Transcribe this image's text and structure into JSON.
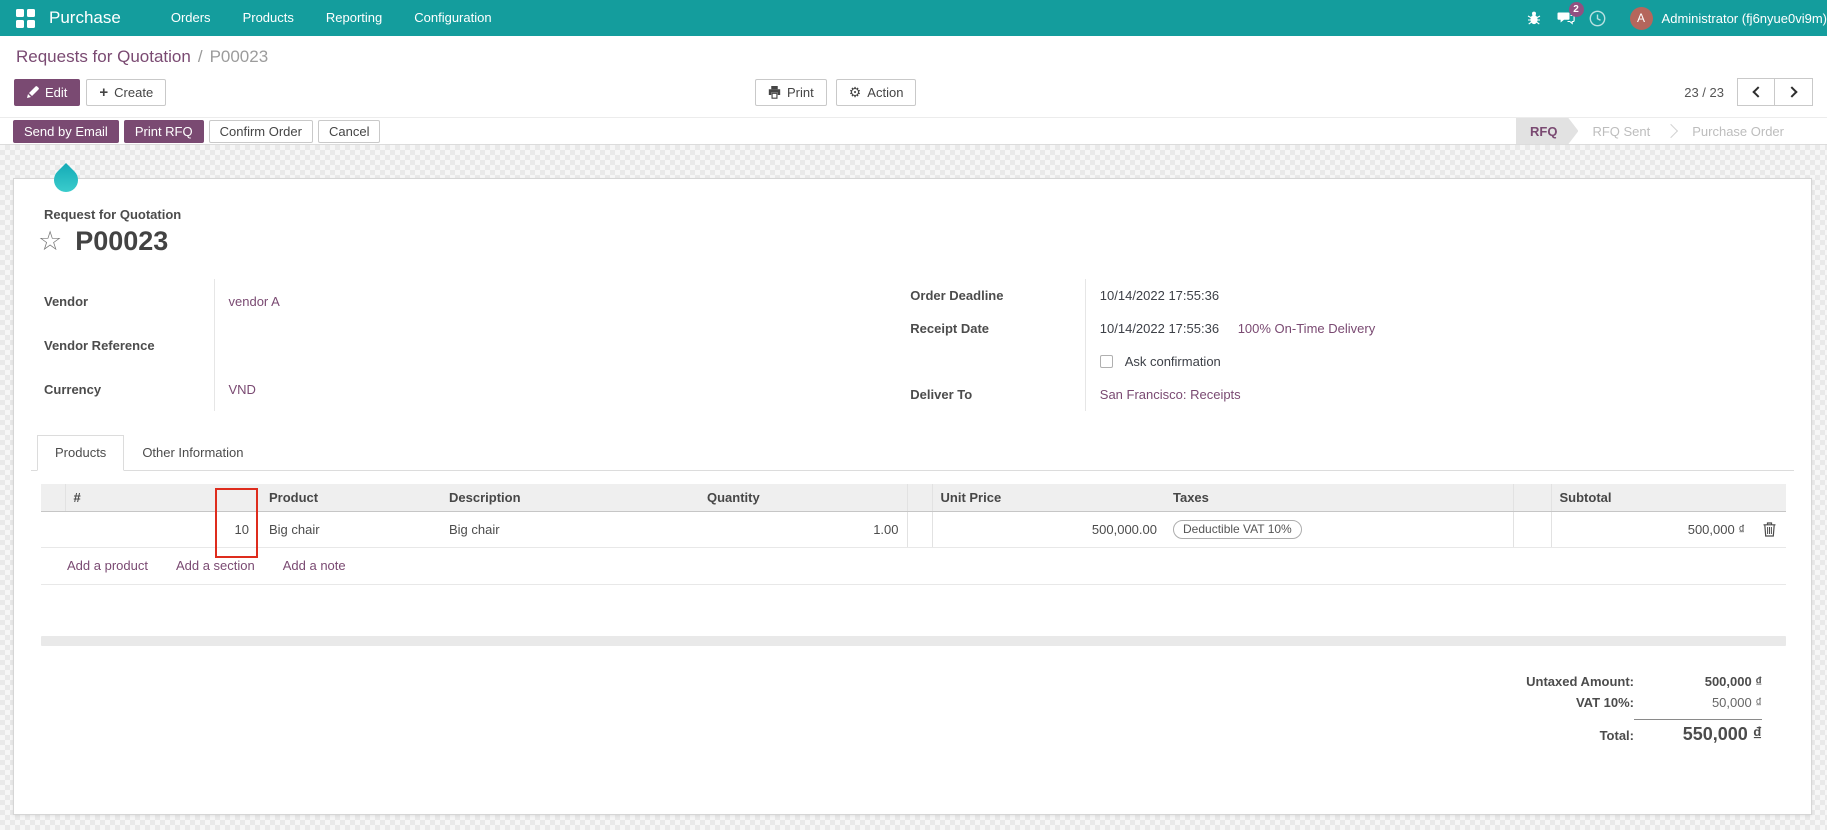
{
  "navbar": {
    "app_name": "Purchase",
    "menus": [
      {
        "label": "Orders"
      },
      {
        "label": "Products"
      },
      {
        "label": "Reporting"
      },
      {
        "label": "Configuration"
      }
    ],
    "systray": {
      "message_count": "2",
      "user_initial": "A",
      "user_name": "Administrator (fj6nyue0vi9m)"
    }
  },
  "control_panel": {
    "breadcrumb_parent": "Requests for Quotation",
    "breadcrumb_sep": "/",
    "breadcrumb_current": "P00023",
    "edit_label": "Edit",
    "create_label": "Create",
    "create_icon": "+",
    "print_label": "Print",
    "action_label": "Action",
    "action_icon": "⚙",
    "pager_value": "23 / 23"
  },
  "statusbar": {
    "send_by_email": "Send by Email",
    "print_rfq": "Print RFQ",
    "confirm_order": "Confirm Order",
    "cancel": "Cancel",
    "stages": [
      {
        "label": "RFQ",
        "active": true
      },
      {
        "label": "RFQ Sent",
        "active": false
      },
      {
        "label": "Purchase Order",
        "active": false
      }
    ]
  },
  "sheet": {
    "doc_label": "Request for Quotation",
    "title": "P00023",
    "star_icon": "☆",
    "left_fields": [
      {
        "label": "Vendor",
        "value": "vendor A"
      },
      {
        "label": "Vendor Reference",
        "value": ""
      },
      {
        "label": "Currency",
        "value": "VND"
      }
    ],
    "right_fields": {
      "order_deadline_label": "Order Deadline",
      "order_deadline_value": "10/14/2022 17:55:36",
      "receipt_date_label": "Receipt Date",
      "receipt_date_value": "10/14/2022 17:55:36",
      "on_time_link": "100% On-Time Delivery",
      "ask_confirmation_label": "Ask confirmation",
      "deliver_to_label": "Deliver To",
      "deliver_to_value": "San Francisco: Receipts"
    },
    "tabs": [
      {
        "label": "Products",
        "active": true
      },
      {
        "label": "Other Information",
        "active": false
      }
    ],
    "table": {
      "col_seq": "#",
      "col_product": "Product",
      "col_description": "Description",
      "col_quantity": "Quantity",
      "col_unit_price": "Unit Price",
      "col_taxes": "Taxes",
      "col_subtotal": "Subtotal",
      "row": {
        "seq": "10",
        "product": "Big chair",
        "description": "Big chair",
        "quantity": "1.00",
        "unit_price": "500,000.00",
        "tax_tag": "Deductible VAT 10%",
        "subtotal": "500,000 ₫"
      },
      "add_product": "Add a product",
      "add_section": "Add a section",
      "add_note": "Add a note"
    },
    "totals": {
      "untaxed_label": "Untaxed Amount:",
      "untaxed_value": "500,000 ₫",
      "vat_label": "VAT 10%:",
      "vat_value": "50,000 ₫",
      "total_label": "Total:",
      "total_value": "550,000 ₫"
    }
  },
  "colors": {
    "navbar_teal": "#149d9d",
    "primary_purple": "#7a4a72",
    "badge_pink": "#915081",
    "avatar_red": "#b5665c",
    "annotation_red": "#de2c1d",
    "droplet_teal": "#2cc0c6"
  }
}
